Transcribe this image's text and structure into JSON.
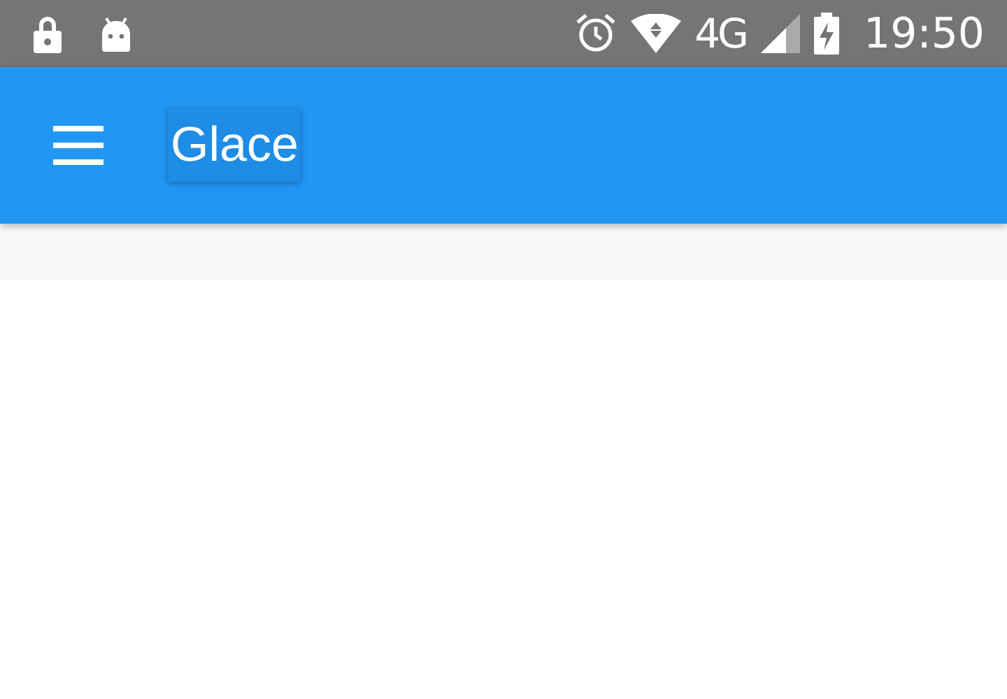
{
  "status_bar": {
    "network": "4G",
    "time": "19:50"
  },
  "app_bar": {
    "title": "Glace"
  }
}
